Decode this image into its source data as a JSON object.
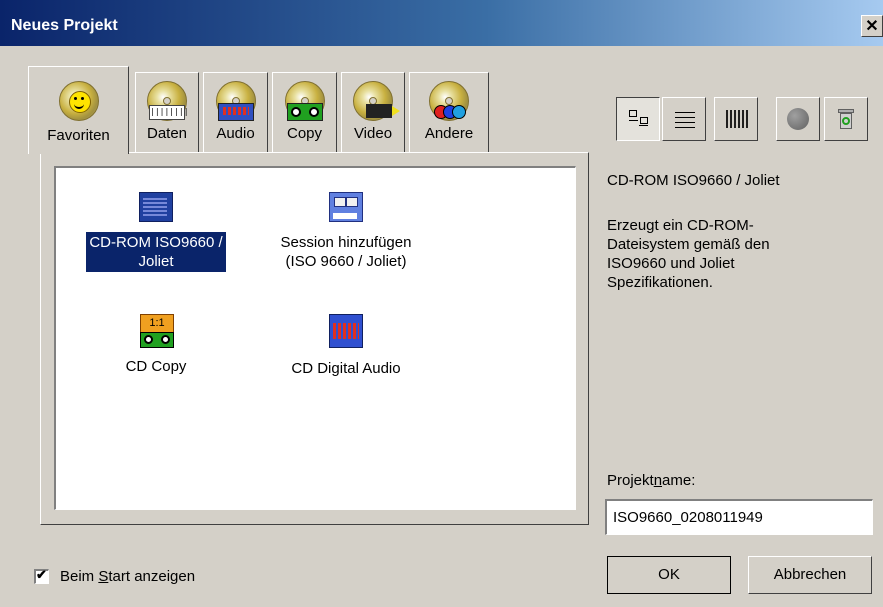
{
  "window": {
    "title": "Neues Projekt",
    "close_glyph": "✕"
  },
  "tabs": [
    {
      "label": "Favoriten",
      "icon": "smiley-disc-icon",
      "active": true
    },
    {
      "label": "Daten",
      "icon": "data-disc-icon",
      "active": false
    },
    {
      "label": "Audio",
      "icon": "audio-disc-icon",
      "active": false
    },
    {
      "label": "Copy",
      "icon": "copy-disc-icon",
      "active": false
    },
    {
      "label": "Video",
      "icon": "video-disc-icon",
      "active": false
    },
    {
      "label": "Andere",
      "icon": "other-disc-icon",
      "active": false
    }
  ],
  "projects": [
    {
      "line1": "CD-ROM ISO9660 /",
      "line2": "Joliet",
      "icon": "cdrom-data-icon",
      "selected": true
    },
    {
      "line1": "Session hinzufügen",
      "line2": "(ISO 9660 / Joliet)",
      "icon": "session-add-icon",
      "selected": false
    },
    {
      "line1": "CD Copy",
      "line2": "",
      "icon": "cd-copy-icon",
      "badge": "1:1",
      "selected": false
    },
    {
      "line1": "CD Digital Audio",
      "line2": "",
      "icon": "cd-audio-icon",
      "selected": false
    }
  ],
  "view_buttons": [
    {
      "name": "large-icons-view-icon",
      "pressed": true
    },
    {
      "name": "small-icons-view-icon",
      "pressed": false
    },
    {
      "name": "details-view-icon",
      "pressed": false
    },
    {
      "name": "record-icon",
      "pressed": false
    },
    {
      "name": "recycle-bin-icon",
      "pressed": false
    }
  ],
  "description": {
    "title": "CD-ROM ISO9660 / Joliet",
    "body": "Erzeugt ein CD-ROM-\nDateisystem gemäß den\nISO9660 und Joliet\nSpezifikationen."
  },
  "projectname": {
    "label_pre": "Projekt",
    "label_accel": "n",
    "label_post": "ame:",
    "value": "ISO9660_0208011949"
  },
  "buttons": {
    "ok": "OK",
    "cancel": "Abbrechen"
  },
  "startup_checkbox": {
    "checked": true,
    "label_pre": "Beim ",
    "label_accel": "S",
    "label_post": "tart anzeigen",
    "check_glyph": "✔"
  },
  "colors": {
    "selection": "#0a246a",
    "title_start": "#0a246a",
    "title_end": "#a6caf0"
  }
}
